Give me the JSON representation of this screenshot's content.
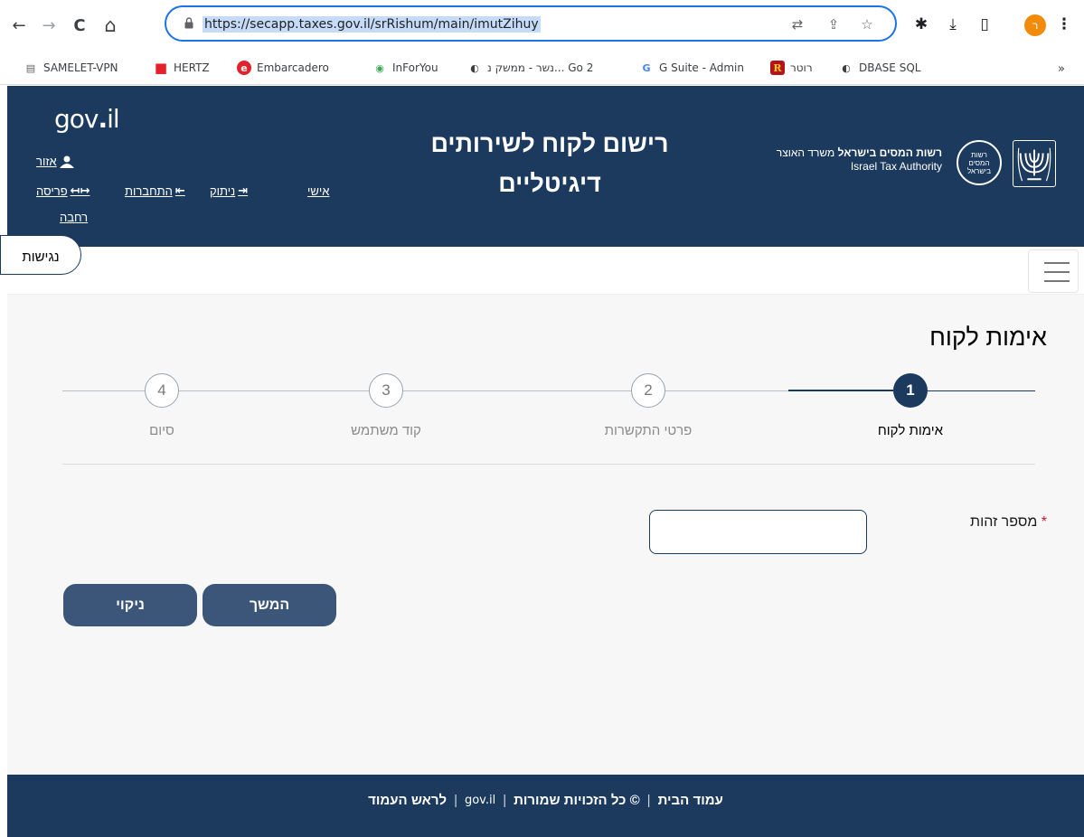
{
  "browser": {
    "nav": {
      "back": "←",
      "forward": "→",
      "reload": "C",
      "home": "⌂"
    },
    "url": "https://secapp.taxes.gov.il/srRishum/main/imutZihuy",
    "omni_icons": {
      "translate": "⇄",
      "share": "⇪",
      "star": "☆"
    },
    "toolbar": {
      "extensions": "✱",
      "downloads": "⤓",
      "sidepanel": "▯",
      "profile": "ר",
      "menu": "⋮"
    }
  },
  "bookmarks": {
    "items": [
      {
        "label": "SAMELET-VPN",
        "icon": "▤",
        "icon_color": "#5f6368",
        "icon_bg": "#ffffff"
      },
      {
        "label": "HERTZ",
        "icon": "■",
        "icon_color": "#e4202a",
        "icon_bg": "#ffffff"
      },
      {
        "label": "Embarcadero",
        "icon": "e",
        "icon_color": "#ffffff",
        "icon_bg": "#e4202a"
      },
      {
        "label": "InForYou",
        "icon": "◉",
        "icon_color": "#3aa757",
        "icon_bg": "#ffffff"
      },
      {
        "label": "Go 2 ...נשר - ממשק נ",
        "icon": "◐",
        "icon_color": "#202124",
        "icon_bg": "#ffffff"
      },
      {
        "label": "G Suite - Admin",
        "icon": "G",
        "icon_color": "#4285f4",
        "icon_bg": "#ffffff"
      },
      {
        "label": "רוטר",
        "icon": "R",
        "icon_color": "#ffffff",
        "icon_bg": "#b5121b"
      },
      {
        "label": "DBASE SQL",
        "icon": "◐",
        "icon_color": "#202124",
        "icon_bg": "#ffffff"
      }
    ],
    "more": "»"
  },
  "header": {
    "logo": {
      "gov": "gov",
      "dot": ".",
      "il": "il"
    },
    "links": {
      "area": "אזור",
      "personal": "אישי",
      "disconnect": "ניתוק",
      "connection": "התחברות",
      "wide_layout": "פריסה",
      "wide_layout_2": "רחבה"
    },
    "title_line1": "רישום לקוח לשירותים",
    "title_line2": "דיגיטליים",
    "authority_he_bold": "רשות המסים בישראל",
    "authority_he_rest": " משרד האוצר",
    "authority_en": "Israel Tax Authority",
    "seal_text": "רשות המסים בישראל"
  },
  "strip": {
    "accessibility": "נגישות"
  },
  "page": {
    "heading": "אימות לקוח",
    "steps": [
      {
        "num": "1",
        "label": "אימות לקוח",
        "state": "active"
      },
      {
        "num": "2",
        "label": "פרטי התקשרות",
        "state": "inactive"
      },
      {
        "num": "3",
        "label": "קוד משתמש",
        "state": "inactive"
      },
      {
        "num": "4",
        "label": "סיום",
        "state": "inactive"
      }
    ],
    "form": {
      "id_label": "מספר זהות",
      "required_mark": "*",
      "id_value": "",
      "id_placeholder": ""
    },
    "buttons": {
      "continue": "המשך",
      "clear": "ניקוי"
    }
  },
  "footer": {
    "home": "עמוד הבית",
    "copyright": "© כל הזכויות שמורות",
    "logo": "gov.il",
    "top": "לראש העמוד",
    "separator": "|"
  },
  "colors": {
    "brand_navy": "#1b3a5e",
    "button": "#3b5678",
    "required": "#c8102e",
    "focus_blue": "#1a73e8"
  }
}
